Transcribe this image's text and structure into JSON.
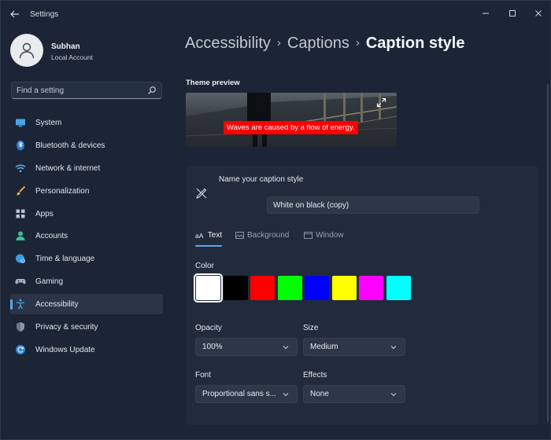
{
  "window": {
    "app_title": "Settings",
    "back_icon": "arrow-left-icon",
    "minimize_icon": "minimize-icon",
    "maximize_icon": "maximize-icon",
    "close_icon": "close-icon"
  },
  "profile": {
    "name": "Subhan",
    "account_type": "Local Account"
  },
  "search": {
    "placeholder": "Find a setting"
  },
  "sidebar": {
    "items": [
      {
        "label": "System",
        "icon": "monitor-icon"
      },
      {
        "label": "Bluetooth & devices",
        "icon": "bluetooth-icon"
      },
      {
        "label": "Network & internet",
        "icon": "wifi-icon"
      },
      {
        "label": "Personalization",
        "icon": "brush-icon"
      },
      {
        "label": "Apps",
        "icon": "apps-grid-icon"
      },
      {
        "label": "Accounts",
        "icon": "person-icon"
      },
      {
        "label": "Time & language",
        "icon": "globe-clock-icon"
      },
      {
        "label": "Gaming",
        "icon": "gamepad-icon"
      },
      {
        "label": "Accessibility",
        "icon": "accessibility-icon"
      },
      {
        "label": "Privacy & security",
        "icon": "shield-icon"
      },
      {
        "label": "Windows Update",
        "icon": "update-icon"
      }
    ],
    "active_index": 8
  },
  "breadcrumb": {
    "items": [
      "Accessibility",
      "Captions",
      "Caption style"
    ]
  },
  "preview": {
    "title": "Theme preview",
    "caption_text": "Waves are caused by a flow of energy.",
    "caption_bg": "#ff0000",
    "caption_fg": "#ffffff",
    "expand_icon": "expand-icon"
  },
  "style_card": {
    "name_label": "Name your caption style",
    "name_value": "White on black (copy)",
    "tabs": [
      {
        "label": "Text",
        "icon": "text-icon"
      },
      {
        "label": "Background",
        "icon": "background-icon"
      },
      {
        "label": "Window",
        "icon": "window-icon"
      }
    ],
    "active_tab": 0,
    "color_label": "Color",
    "colors": [
      "#ffffff",
      "#000000",
      "#ff0000",
      "#00ff00",
      "#0000ff",
      "#ffff00",
      "#ff00ff",
      "#00ffff"
    ],
    "selected_color": 0,
    "opacity": {
      "label": "Opacity",
      "value": "100%"
    },
    "size": {
      "label": "Size",
      "value": "Medium"
    },
    "font": {
      "label": "Font",
      "value": "Proportional sans s..."
    },
    "effects": {
      "label": "Effects",
      "value": "None"
    }
  },
  "accent": "#5ea9e6"
}
